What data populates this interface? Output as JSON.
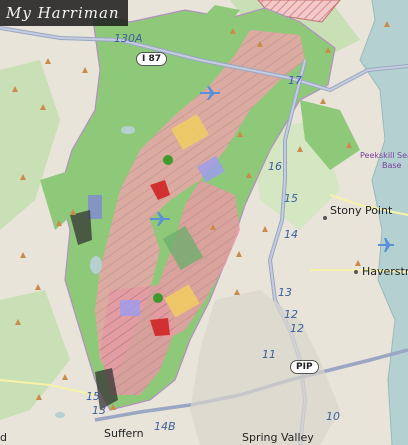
{
  "title": "My Harriman",
  "labels": {
    "stony_point": "Stony Point",
    "haverstraw": "Haverstra",
    "peekskill": "Peekskill Sea",
    "peekskill2": "Base",
    "suffern": "Suffern",
    "spring_valley": "Spring Valley",
    "left_edge": "d"
  },
  "highways": {
    "n17": "17",
    "n16": "16",
    "n15": "15",
    "n14": "14",
    "n13": "13",
    "n12a": "12",
    "n12b": "12",
    "n11": "11",
    "n10": "10",
    "n15b": "15",
    "n13b": "13",
    "n130a": "130A",
    "n14b": "14B"
  },
  "shields": {
    "i87": "I 87",
    "pip": "PIP"
  },
  "colors": {
    "forest": "#8ec97a",
    "land": "#e8e4da",
    "park_outline": "#b58fbf",
    "water": "#b5d0d0",
    "highway": "#9aa6c2",
    "trail_red": "#e56b77",
    "trail_blue": "#7f7fe0",
    "trail_yellow": "#f2d15c"
  }
}
